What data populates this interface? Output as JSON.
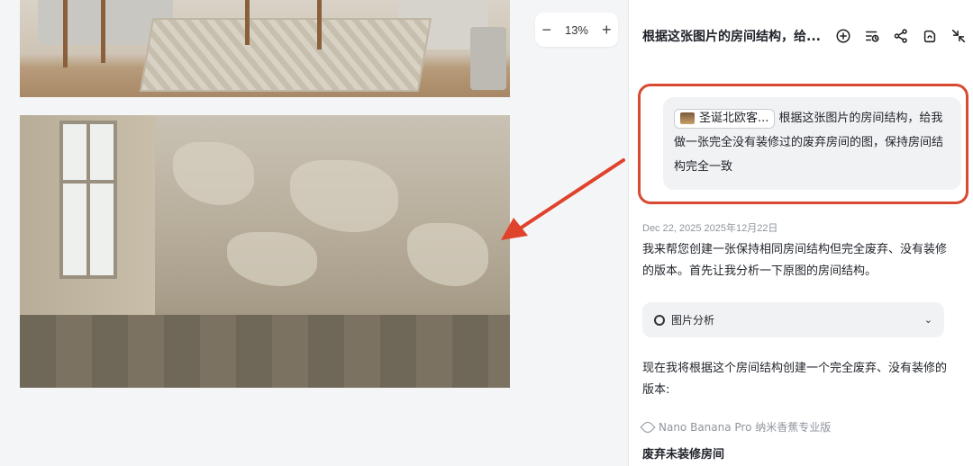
{
  "zoom": {
    "minus": "−",
    "value": "13%",
    "plus": "+"
  },
  "panel": {
    "title": "根据这张图片的房间结构，给...",
    "icons": [
      "add-circle-icon",
      "history-icon",
      "share-icon",
      "cloud-icon",
      "collapse-icon"
    ]
  },
  "user_message": {
    "chip_label": "圣诞北欧客...",
    "text": "根据这张图片的房间结构，给我做一张完全没有装修过的废弃房间的图，保持房间结构完全一致"
  },
  "reply": {
    "date": "Dec 22, 2025  2025年12月22日",
    "intro": "我来帮您创建一张保持相同房间结构但完全废弃、没有装修的版本。首先让我分析一下原图的房间结构。",
    "tool_label": "图片分析",
    "tool_chevron": "⌄",
    "followup": "现在我将根据这个房间结构创建一个完全废弃、没有装修的版本:",
    "model_name": "Nano Banana Pro  纳米香蕉专业版",
    "section_title": "废弃未装修房间"
  },
  "colors": {
    "highlight": "#d84a32",
    "arrow": "#e0432b"
  }
}
